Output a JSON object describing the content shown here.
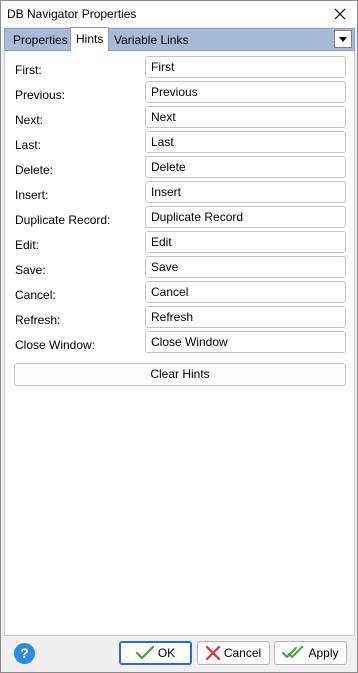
{
  "window": {
    "title": "DB Navigator Properties"
  },
  "tabs": [
    {
      "label": "Properties",
      "active": false
    },
    {
      "label": "Hints",
      "active": true
    },
    {
      "label": "Variable Links",
      "active": false
    }
  ],
  "hints": [
    {
      "label": "First:",
      "value": "First"
    },
    {
      "label": "Previous:",
      "value": "Previous"
    },
    {
      "label": "Next:",
      "value": "Next"
    },
    {
      "label": "Last:",
      "value": "Last"
    },
    {
      "label": "Delete:",
      "value": "Delete"
    },
    {
      "label": "Insert:",
      "value": "Insert"
    },
    {
      "label": "Duplicate Record:",
      "value": "Duplicate Record"
    },
    {
      "label": "Edit:",
      "value": "Edit"
    },
    {
      "label": "Save:",
      "value": "Save"
    },
    {
      "label": "Cancel:",
      "value": "Cancel"
    },
    {
      "label": "Refresh:",
      "value": "Refresh"
    },
    {
      "label": "Close Window:",
      "value": "Close Window"
    }
  ],
  "clear_hints_label": "Clear Hints",
  "footer": {
    "help_label": "?",
    "ok_label": "OK",
    "cancel_label": "Cancel",
    "apply_label": "Apply"
  },
  "colors": {
    "tab_bar": "#a9bad8",
    "accent": "#2a6ad3",
    "ok_check": "#3fa535",
    "cancel_x": "#e03030",
    "help": "#2d8ae6"
  }
}
